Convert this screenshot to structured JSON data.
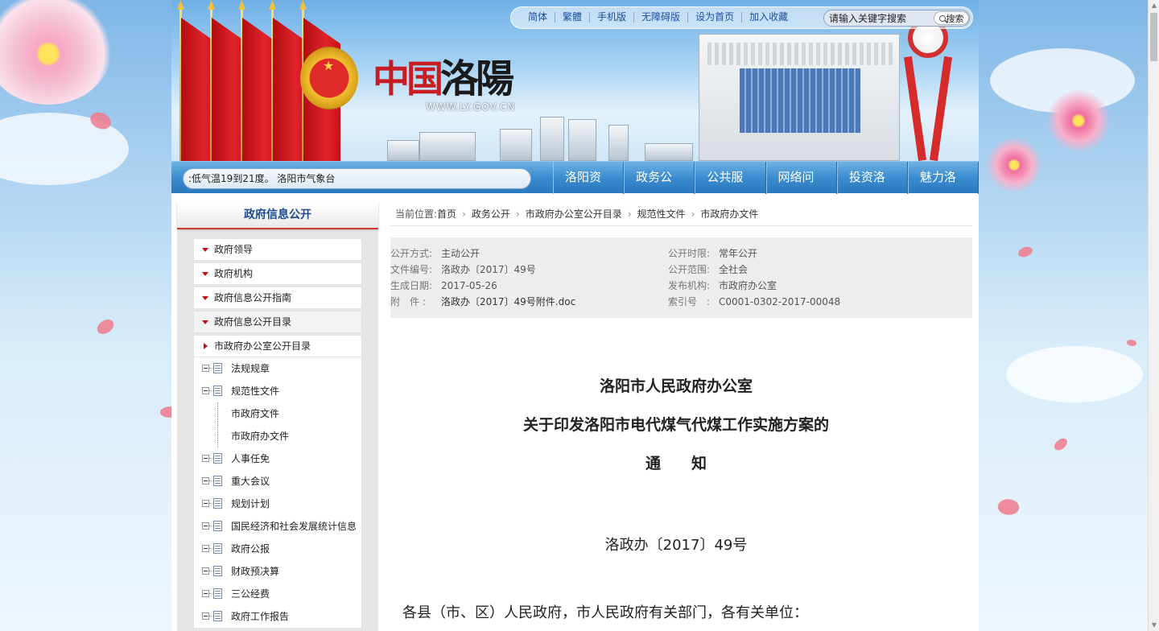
{
  "colors": {
    "brand_red": "#c71c21",
    "nav_blue": "#2b78bd",
    "link_blue": "#1c4f9c",
    "sidebar_title": "#1d4b8e"
  },
  "topbar": {
    "links": [
      "简体",
      "繁體",
      "手机版",
      "无障碍版",
      "设为首页",
      "加入收藏"
    ],
    "search_placeholder": "请输入关键字搜索",
    "search_button": "搜索"
  },
  "banner": {
    "logo_zh": "中国",
    "logo_ly": "洛陽",
    "url": "WWW.LY.GOV.CN"
  },
  "nav": {
    "ticker": ":低气温19到21度。  洛阳市气象台",
    "items": [
      "洛阳资讯",
      "政务公开",
      "公共服务",
      "网络问政",
      "投资洛阳",
      "魅力洛阳"
    ]
  },
  "sidebar": {
    "title": "政府信息公开",
    "items": [
      "政府领导",
      "政府机构",
      "政府信息公开指南",
      "政府信息公开目录"
    ],
    "subitem": "市政府办公室公开目录",
    "tree": [
      {
        "label": "法规规章",
        "type": "node"
      },
      {
        "label": "规范性文件",
        "type": "node"
      },
      {
        "label": "市政府文件",
        "type": "leaf"
      },
      {
        "label": "市政府办文件",
        "type": "leaf"
      },
      {
        "label": "人事任免",
        "type": "node"
      },
      {
        "label": "重大会议",
        "type": "node"
      },
      {
        "label": "规划计划",
        "type": "node"
      },
      {
        "label": "国民经济和社会发展统计信息",
        "type": "node"
      },
      {
        "label": "政府公报",
        "type": "node"
      },
      {
        "label": "财政预决算",
        "type": "node"
      },
      {
        "label": "三公经费",
        "type": "node"
      },
      {
        "label": "政府工作报告",
        "type": "node"
      }
    ]
  },
  "breadcrumb": {
    "prefix": "当前位置:",
    "items": [
      "首页",
      "政务公开",
      "市政府办公室公开目录",
      "规范性文件",
      "市政府办文件"
    ]
  },
  "meta": {
    "left": [
      {
        "k": "公开方式:",
        "v": "主动公开"
      },
      {
        "k": "文件编号:",
        "v": "洛政办〔2017〕49号"
      },
      {
        "k": "生成日期:",
        "v": "2017-05-26"
      },
      {
        "k": "附　件 :",
        "v": "洛政办〔2017〕49号附件.doc"
      }
    ],
    "right": [
      {
        "k": "公开时限:",
        "v": "常年公开"
      },
      {
        "k": "公开范围:",
        "v": "全社会"
      },
      {
        "k": "发布机构:",
        "v": "市政府办公室"
      },
      {
        "k": "索引号　:",
        "v": "C0001-0302-2017-00048"
      }
    ]
  },
  "document": {
    "title_lines": [
      "洛阳市人民政府办公室",
      "关于印发洛阳市电代煤气代煤工作实施方案的",
      "通　　知"
    ],
    "number": "洛政办〔2017〕49号",
    "salutation": "各县（市、区）人民政府，市人民政府有关部门，各有关单位："
  }
}
